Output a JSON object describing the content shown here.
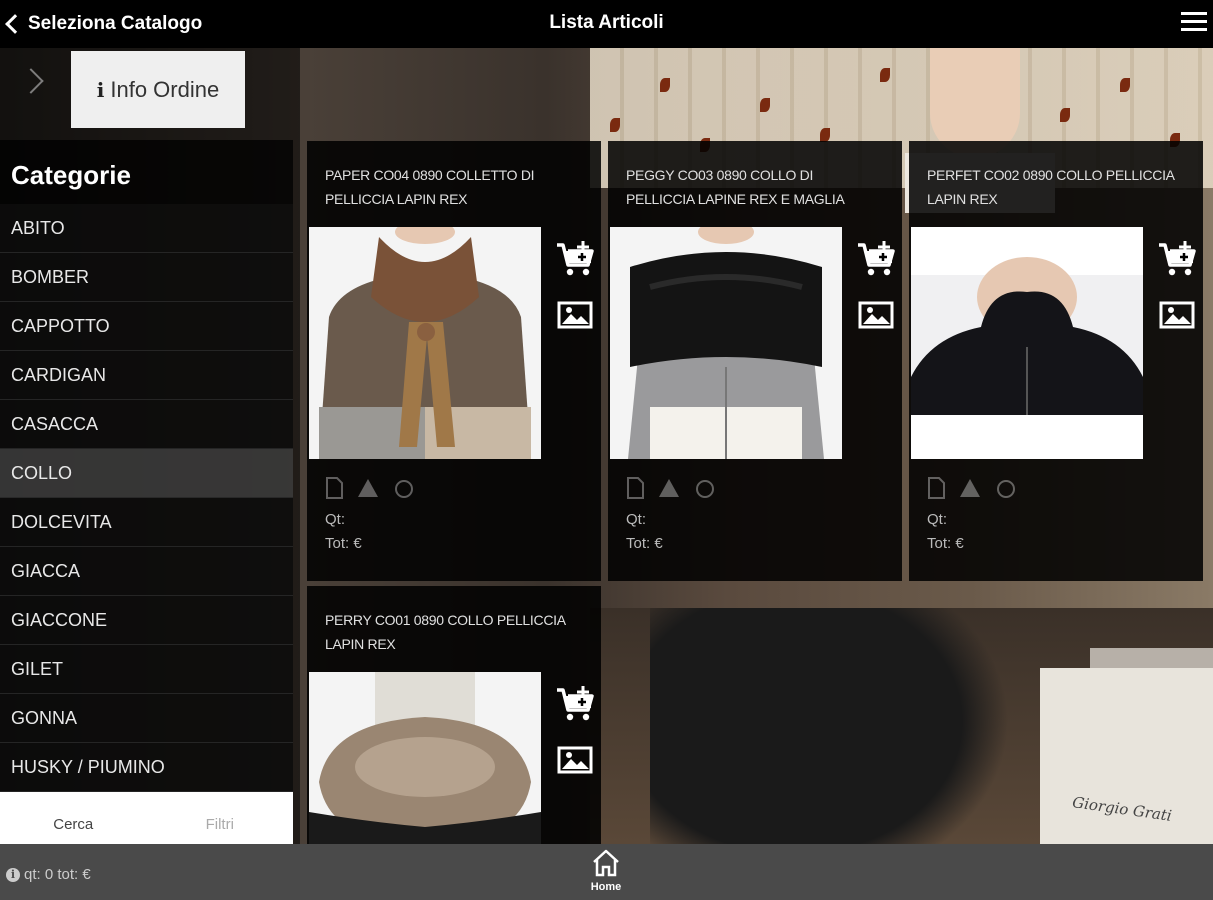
{
  "header": {
    "back_label": "Seleziona Catalogo",
    "title": "Lista Articoli",
    "menu_icon": "hamburger-icon"
  },
  "info_order": {
    "label": "Info Ordine",
    "icon": "info-icon"
  },
  "sidebar": {
    "title": "Categorie",
    "items": [
      {
        "label": "ABITO",
        "selected": false
      },
      {
        "label": "BOMBER",
        "selected": false
      },
      {
        "label": "CAPPOTTO",
        "selected": false
      },
      {
        "label": "CARDIGAN",
        "selected": false
      },
      {
        "label": "CASACCA",
        "selected": false
      },
      {
        "label": "COLLO",
        "selected": true
      },
      {
        "label": "DOLCEVITA",
        "selected": false
      },
      {
        "label": "GIACCA",
        "selected": false
      },
      {
        "label": "GIACCONE",
        "selected": false
      },
      {
        "label": "GILET",
        "selected": false
      },
      {
        "label": "GONNA",
        "selected": false
      },
      {
        "label": "HUSKY / PIUMINO",
        "selected": false
      }
    ],
    "tabs": {
      "search": "Cerca",
      "filters": "Filtri"
    }
  },
  "products": [
    {
      "name": "PAPER CO04 0890 COLLETTO DI PELLICCIA LAPIN REX",
      "qt_label": "Qt:",
      "tot_label": "Tot: €"
    },
    {
      "name": "PEGGY CO03 0890 COLLO DI PELLICCIA LAPINE REX E MAGLIA",
      "qt_label": "Qt:",
      "tot_label": "Tot: €"
    },
    {
      "name": "PERFET CO02 0890 COLLO PELLICCIA LAPIN REX",
      "qt_label": "Qt:",
      "tot_label": "Tot: €"
    },
    {
      "name": "PERRY CO01 0890 COLLO PELLICCIA LAPIN REX",
      "qt_label": "",
      "tot_label": ""
    }
  ],
  "footer": {
    "summary": "qt: 0 tot: €",
    "home_label": "Home"
  },
  "background": {
    "signature": "Giorgio Grati"
  }
}
